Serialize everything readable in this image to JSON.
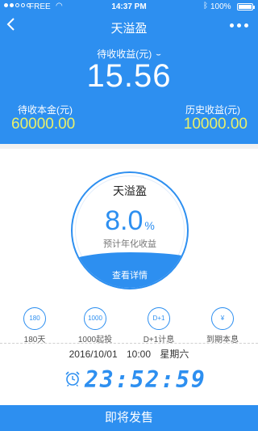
{
  "status_bar": {
    "carrier": "FREE",
    "time": "14:37 PM",
    "battery": "100%"
  },
  "nav": {
    "title": "天溢盈",
    "back_icon": "chevron-left-icon",
    "more_icon": "more-dots-icon"
  },
  "summary": {
    "pending_label": "待收收益(元)",
    "pending_value": "15.56",
    "principal_label": "待收本金(元)",
    "principal_value": "60000.00",
    "history_label": "历史收益(元)",
    "history_value": "10000.00"
  },
  "product": {
    "name": "天溢盈",
    "rate": "8.0",
    "rate_unit": "%",
    "rate_label": "预计年化收益",
    "details_link": "查看详情"
  },
  "features": [
    {
      "icon_text": "180",
      "icon": "calendar-icon",
      "label": "180天"
    },
    {
      "icon_text": "1000",
      "icon": "money-icon",
      "label": "1000起投"
    },
    {
      "icon_text": "D+1",
      "icon": "interest-icon",
      "label": "D+1计息"
    },
    {
      "icon_text": "¥",
      "icon": "coins-icon",
      "label": "到期本息"
    }
  ],
  "countdown": {
    "date": "2016/10/01",
    "time": "10:00",
    "weekday": "星期六",
    "timer": "23:52:59"
  },
  "bottom_button": "即将发售",
  "colors": {
    "primary": "#2d8ff0",
    "highlight": "#e9f06a"
  }
}
